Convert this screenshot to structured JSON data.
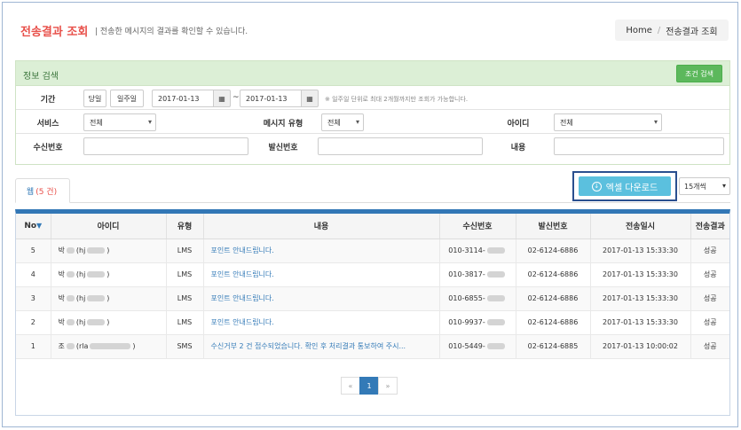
{
  "header": {
    "title": "전송결과 조회",
    "subtitle": "| 전송한 메시지의 결과를 확인할 수 있습니다.",
    "breadcrumb": [
      "Home",
      "전송결과 조회"
    ]
  },
  "search": {
    "panel_title": "정보 검색",
    "search_button": "조건 검색",
    "period_label": "기간",
    "today_button": "당일",
    "week_button": "일주일",
    "date_from": "2017-01-13",
    "date_to": "2017-01-13",
    "date_separator": "~",
    "date_hint": "※ 일주일 단위로 최대 2개월까지만 조회가 가능합니다.",
    "service_label": "서비스",
    "service_value": "전체",
    "msg_type_label": "메시지 유형",
    "msg_type_value": "전체",
    "id_label": "아이디",
    "id_value": "전체",
    "receiver_label": "수신번호",
    "receiver_value": "",
    "sender_label": "발신번호",
    "sender_value": "",
    "content_label": "내용",
    "content_value": ""
  },
  "tabs": {
    "web_label": "웹",
    "web_count": "(5 건)"
  },
  "toolbar": {
    "excel_button": "엑셀 다운로드",
    "page_size": "15개씩"
  },
  "table": {
    "columns": [
      "No",
      "아이디",
      "유형",
      "내용",
      "수신번호",
      "발신번호",
      "전송일시",
      "전송결과"
    ],
    "rows": [
      {
        "no": "5",
        "id_a": "박",
        "id_b": "(hj",
        "id_c": ")",
        "type": "LMS",
        "content": "포인트 안내드립니다.",
        "recv": "010-3114-",
        "send": "02-6124-6886",
        "date": "2017-01-13 15:33:30",
        "result": "성공"
      },
      {
        "no": "4",
        "id_a": "박",
        "id_b": "(hj",
        "id_c": ")",
        "type": "LMS",
        "content": "포인트 안내드립니다.",
        "recv": "010-3817-",
        "send": "02-6124-6886",
        "date": "2017-01-13 15:33:30",
        "result": "성공"
      },
      {
        "no": "3",
        "id_a": "박",
        "id_b": "(hj",
        "id_c": ")",
        "type": "LMS",
        "content": "포인트 안내드립니다.",
        "recv": "010-6855-",
        "send": "02-6124-6886",
        "date": "2017-01-13 15:33:30",
        "result": "성공"
      },
      {
        "no": "2",
        "id_a": "박",
        "id_b": "(hj",
        "id_c": ")",
        "type": "LMS",
        "content": "포인트 안내드립니다.",
        "recv": "010-9937-",
        "send": "02-6124-6886",
        "date": "2017-01-13 15:33:30",
        "result": "성공"
      },
      {
        "no": "1",
        "id_a": "조",
        "id_b": "(rla",
        "id_c": ")",
        "type": "SMS",
        "content": "수신거부 2 건 접수되었습니다. 확인 후 처리결과 통보하여 주시...",
        "recv": "010-5449-",
        "send": "02-6124-6885",
        "date": "2017-01-13 10:00:02",
        "result": "성공"
      }
    ]
  },
  "pagination": {
    "prev": "«",
    "current": "1",
    "next": "»"
  }
}
